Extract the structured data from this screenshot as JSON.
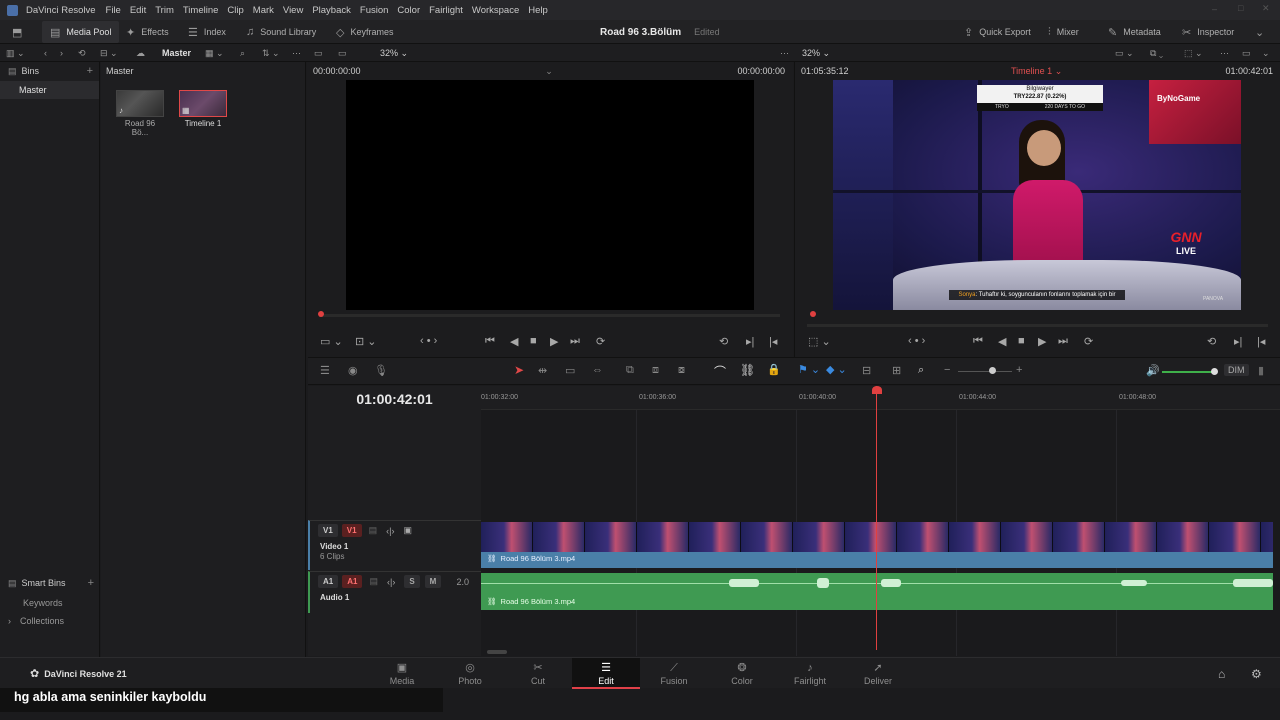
{
  "menubar": {
    "app_title": "DaVinci Resolve",
    "items": [
      "File",
      "Edit",
      "Trim",
      "Timeline",
      "Clip",
      "Mark",
      "View",
      "Playback",
      "Fusion",
      "Color",
      "Fairlight",
      "Workspace",
      "Help"
    ]
  },
  "toolbar": {
    "media_pool": "Media Pool",
    "effects": "Effects",
    "index": "Index",
    "sound_library": "Sound Library",
    "keyframes": "Keyframes",
    "project_title": "Road 96 3.Bölüm",
    "project_status": "Edited",
    "quick_export": "Quick Export",
    "mixer": "Mixer",
    "metadata": "Metadata",
    "inspector": "Inspector"
  },
  "subbar": {
    "master_label": "Master",
    "source_zoom": "32%",
    "timeline_zoom": "32%"
  },
  "bins": {
    "header": "Bins",
    "items": [
      "Master"
    ],
    "smart_bins_header": "Smart Bins",
    "smart_items": [
      "Keywords",
      "Collections"
    ]
  },
  "pool": {
    "breadcrumb": "Master",
    "clips": [
      {
        "label": "Road 96 Bö..."
      },
      {
        "label": "Timeline 1"
      }
    ]
  },
  "source_viewer": {
    "timecode_left": "00:00:00:00",
    "timecode_right": "00:00:00:00"
  },
  "timeline_viewer": {
    "timecode_left": "01:05:35:12",
    "timeline_name": "Timeline 1",
    "timecode_right": "01:00:42:01",
    "overlay_user": "Bilgiwayer",
    "overlay_money": "TRY222.87 (0.22%)",
    "overlay_left": "TRYO",
    "overlay_mid": "220 DAYS TO GO",
    "brand": "ByNoGame",
    "logo_top": "GNN",
    "logo_bottom": "LIVE",
    "subtitle_name": "Sonya",
    "subtitle_text": ": Tuhaftır ki, soygunculanın fonlarını toplamak için bir",
    "corner_logo": "PANOVA"
  },
  "timeline": {
    "current_timecode": "01:00:42:01",
    "ruler": [
      "01:00:32:00",
      "01:00:36:00",
      "01:00:40:00",
      "01:00:44:00",
      "01:00:48:00"
    ],
    "dim_label": "DIM",
    "video_track": {
      "badge_src": "V1",
      "badge_dst": "V1",
      "name": "Video 1",
      "clips": "6 Clips",
      "clip_label": "Road 96 Bölüm 3.mp4"
    },
    "audio_track": {
      "badge_src": "A1",
      "badge_dst": "A1",
      "name": "Audio 1",
      "solo": "S",
      "mute": "M",
      "level": "2.0",
      "clip_label": "Road 96 Bölüm 3.mp4"
    }
  },
  "pages": {
    "brand": "DaVinci Resolve 21",
    "items": [
      {
        "label": "Media",
        "icon": "▣"
      },
      {
        "label": "Photo",
        "icon": "◎"
      },
      {
        "label": "Cut",
        "icon": "✂"
      },
      {
        "label": "Edit",
        "icon": "☰"
      },
      {
        "label": "Fusion",
        "icon": "⟋"
      },
      {
        "label": "Color",
        "icon": "❂"
      },
      {
        "label": "Fairlight",
        "icon": "♪"
      },
      {
        "label": "Deliver",
        "icon": "➚"
      }
    ],
    "active": "Edit"
  },
  "caption": "hg abla ama seninkiler kayboldu",
  "colors": {
    "accent_red": "#e04040",
    "video_clip": "#4a7fa8",
    "audio_clip": "#3f9a52"
  }
}
